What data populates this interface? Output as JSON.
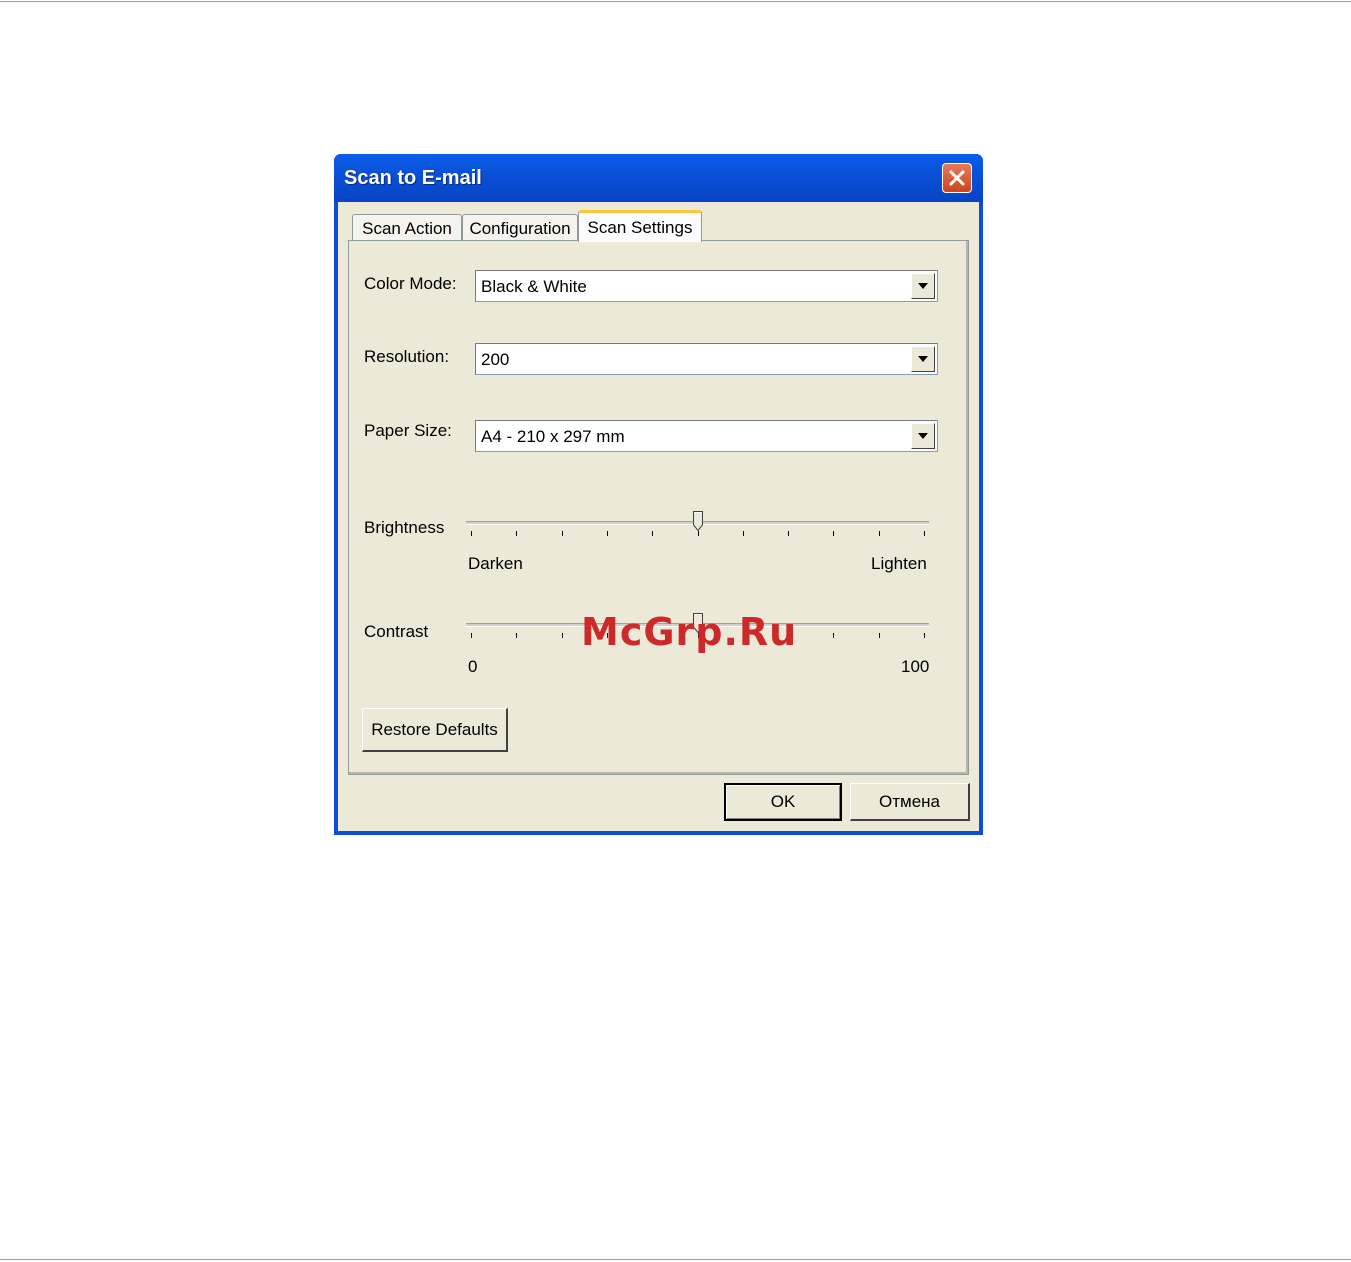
{
  "dialog": {
    "title": "Scan to E-mail",
    "close_icon": "close-icon"
  },
  "tabs": [
    {
      "label": "Scan Action",
      "selected": false
    },
    {
      "label": "Configuration",
      "selected": false
    },
    {
      "label": "Scan Settings",
      "selected": true
    }
  ],
  "fields": {
    "color_mode": {
      "label": "Color Mode:",
      "value": "Black & White"
    },
    "resolution": {
      "label": "Resolution:",
      "value": "200"
    },
    "paper_size": {
      "label": "Paper Size:",
      "value": "A4 - 210 x 297 mm"
    }
  },
  "brightness": {
    "label": "Brightness",
    "min_label": "Darken",
    "max_label": "Lighten",
    "level": 0.5
  },
  "contrast": {
    "label": "Contrast",
    "min_label": "0",
    "max_label": "100",
    "level": 0.5
  },
  "buttons": {
    "restore_defaults": "Restore Defaults",
    "ok": "OK",
    "cancel": "Отмена"
  },
  "watermark": "McGrp.Ru",
  "colors": {
    "titlebar": "#0a4fd6",
    "dialog_bg": "#ece9d8",
    "close": "#d1431c",
    "watermark": "#cc2a2a"
  }
}
